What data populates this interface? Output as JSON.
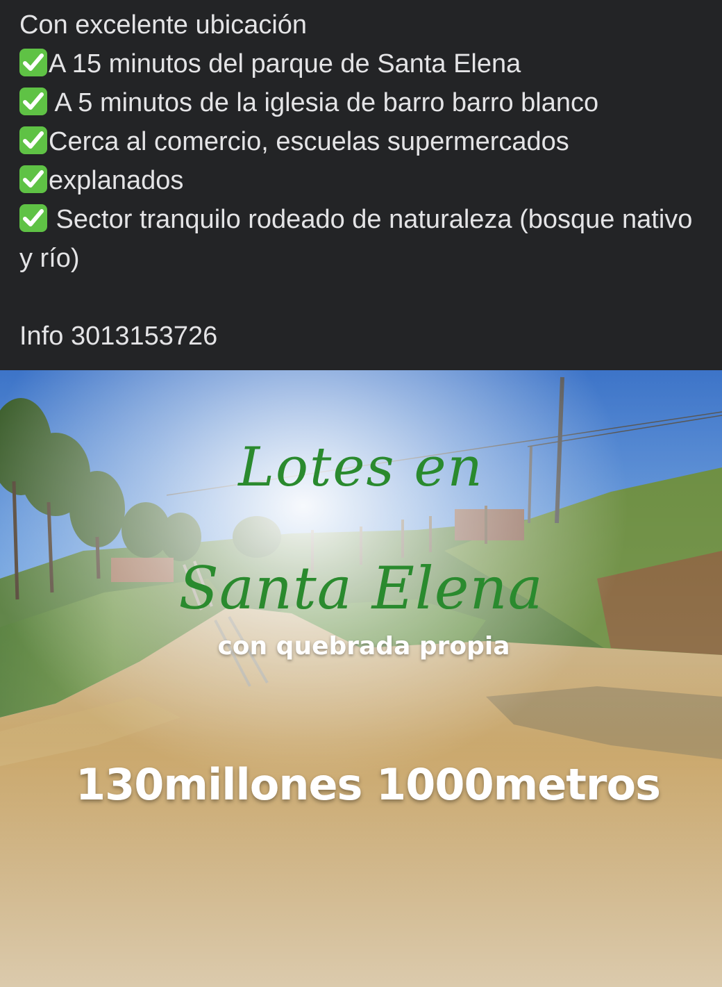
{
  "caption": {
    "intro": "Con excelente ubicación",
    "items": [
      {
        "icon": "check-mark-icon",
        "text": "A 15 minutos del parque de Santa Elena"
      },
      {
        "icon": "check-mark-icon",
        "text": " A 5 minutos de la iglesia de barro barro blanco"
      },
      {
        "icon": "check-mark-icon",
        "text": "Cerca al comercio, escuelas supermercados"
      },
      {
        "icon": "check-mark-icon",
        "text": "explanados"
      },
      {
        "icon": "check-mark-icon",
        "text": " Sector tranquilo rodeado de naturaleza (bosque nativo y río)"
      }
    ],
    "info": "Info 3013153726"
  },
  "image": {
    "title_line1": "Lotes en",
    "title_line2": "Santa Elena",
    "subtitle": "con quebrada propia",
    "price": "130millones 1000metros"
  },
  "colors": {
    "caption_bg": "#232426",
    "caption_text": "#e4e4e6",
    "check_bg": "#5fc245",
    "script_green": "#2a8a2e"
  }
}
